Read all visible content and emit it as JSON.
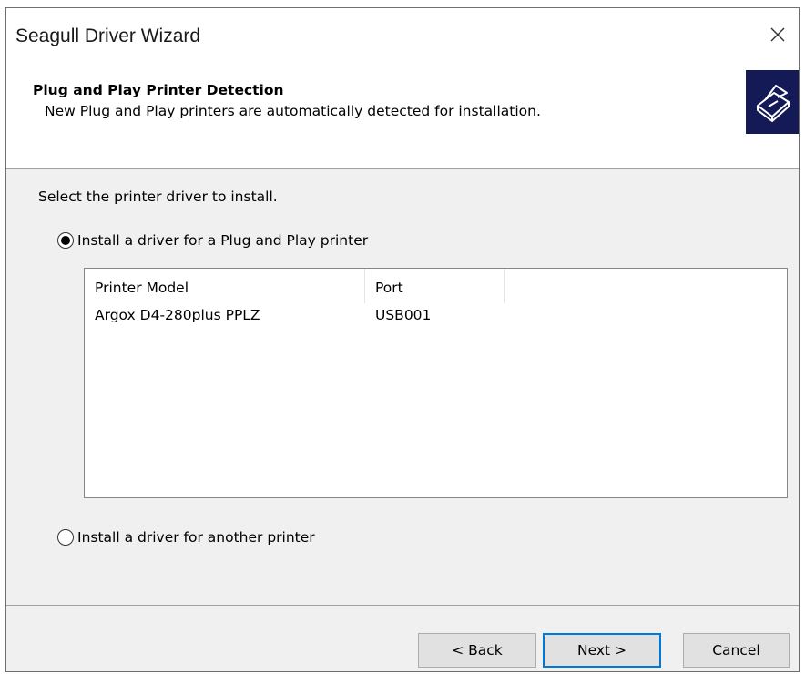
{
  "window": {
    "title": "Seagull Driver Wizard",
    "close_glyph": "✕"
  },
  "header": {
    "title": "Plug and Play Printer Detection",
    "subtitle": "New Plug and Play printers are automatically detected for installation.",
    "icon": "printer-icon",
    "icon_bg": "#141a55"
  },
  "prompt": "Select the printer driver to install.",
  "options": [
    {
      "label": "Install a driver for a Plug and Play printer",
      "selected": true
    },
    {
      "label": "Install a driver for another printer",
      "selected": false
    }
  ],
  "table": {
    "columns": [
      "Printer Model",
      "Port"
    ],
    "rows": [
      {
        "model": "Argox D4-280plus PPLZ",
        "port": "USB001"
      }
    ]
  },
  "buttons": {
    "back": "< Back",
    "next": "Next >",
    "cancel": "Cancel"
  },
  "colors": {
    "accent": "#0078d7",
    "button_face": "#e1e1e1",
    "dialog_bg": "#f0f0f0"
  }
}
